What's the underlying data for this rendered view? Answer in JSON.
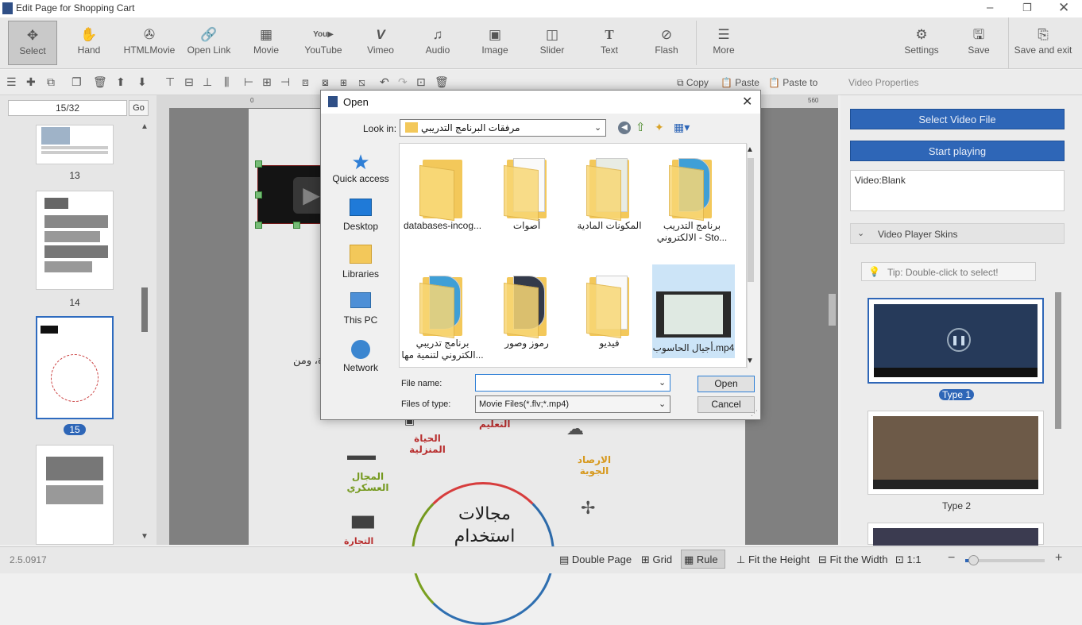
{
  "window": {
    "title": "Edit Page for Shopping Cart"
  },
  "ribbon": {
    "items": [
      {
        "label": "Select",
        "icon": "select-icon"
      },
      {
        "label": "Hand",
        "icon": "hand-icon"
      },
      {
        "label": "HTMLMovie",
        "icon": "film-reel-icon"
      },
      {
        "label": "Open Link",
        "icon": "link-icon"
      },
      {
        "label": "Movie",
        "icon": "movie-icon"
      },
      {
        "label": "YouTube",
        "icon": "youtube-icon"
      },
      {
        "label": "Vimeo",
        "icon": "vimeo-icon"
      },
      {
        "label": "Audio",
        "icon": "music-note-icon"
      },
      {
        "label": "Image",
        "icon": "image-icon"
      },
      {
        "label": "Slider",
        "icon": "slider-icon"
      },
      {
        "label": "Text",
        "icon": "text-icon"
      },
      {
        "label": "Flash",
        "icon": "flash-icon"
      },
      {
        "label": "More",
        "icon": "more-icon"
      }
    ],
    "right": [
      {
        "label": "Settings",
        "icon": "gear-icon"
      },
      {
        "label": "Save",
        "icon": "save-icon"
      },
      {
        "label": "Save and exit",
        "icon": "save-exit-icon"
      }
    ]
  },
  "toolbar": {
    "copy": "Copy",
    "paste": "Paste",
    "paste_to": "Paste to"
  },
  "pages": {
    "current": "15/32",
    "go": "Go",
    "labels": [
      "13",
      "14",
      "15"
    ]
  },
  "canvas": {
    "ruler_top": [
      "0",
      "560"
    ],
    "page_text": "ة، ومن",
    "mindmap": {
      "home": "الحياة المنزلية",
      "military": "المجال العسكري",
      "weather": "الارصاد الجوية",
      "center": "مجالات استخدام",
      "education": "التعليم",
      "bottom": "التجارة"
    }
  },
  "dialog": {
    "title": "Open",
    "look_in_label": "Look in:",
    "look_in_value": "مرفقات البرنامج التدريبي",
    "places": [
      "Quick access",
      "Desktop",
      "Libraries",
      "This PC",
      "Network"
    ],
    "files": [
      {
        "name": "databases-incog...",
        "kind": "folder"
      },
      {
        "name": "أصوات",
        "kind": "folder-doc"
      },
      {
        "name": "المكونات المادية",
        "kind": "folder-doc"
      },
      {
        "name": "برنامج التدريب الالكتروني - Sto...",
        "kind": "folder-globe"
      },
      {
        "name": "برنامج تدريبي الكتروني لتنمية مها...",
        "kind": "folder-globe"
      },
      {
        "name": "رموز وصور",
        "kind": "folder-doc"
      },
      {
        "name": "فيديو",
        "kind": "folder-doc"
      },
      {
        "name": "أجيال الحاسوب.mp4",
        "kind": "video"
      }
    ],
    "file_name_label": "File name:",
    "file_name_value": "",
    "files_of_type_label": "Files of type:",
    "files_of_type_value": "Movie Files(*.flv;*.mp4)",
    "open_button": "Open",
    "cancel_button": "Cancel"
  },
  "properties": {
    "header": "Video Properties",
    "select_file": "Select Video File",
    "start_playing": "Start playing",
    "video_info": "Video:Blank",
    "skins_header": "Video Player Skins",
    "tip": "Tip: Double-click to select!",
    "skins": [
      "Type 1",
      "Type 2"
    ]
  },
  "status": {
    "version": "2.5.0917",
    "double_page": "Double Page",
    "grid": "Grid",
    "rule": "Rule",
    "fit_height": "Fit the Height",
    "fit_width": "Fit the Width",
    "ratio": "1:1",
    "zoom": 0.1
  },
  "colors": {
    "accent": "#2e66b7",
    "selected_item": "#cce4f7"
  }
}
